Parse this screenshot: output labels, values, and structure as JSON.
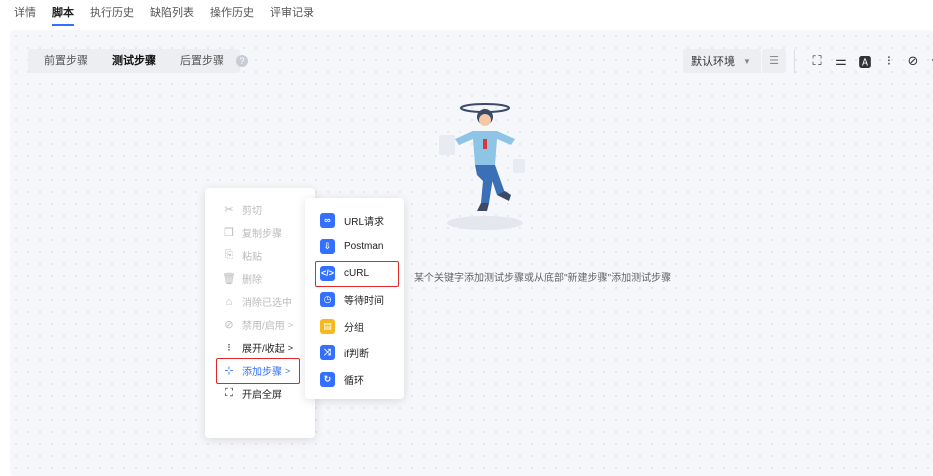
{
  "top_tabs": [
    "详情",
    "脚本",
    "执行历史",
    "缺陷列表",
    "操作历史",
    "评审记录"
  ],
  "active_tab": "脚本",
  "steps_tabs": {
    "pre": "前置步骤",
    "test": "测试步骤",
    "post": "后置步骤"
  },
  "environment": {
    "selected": "默认环境"
  },
  "empty_hint": "某个关键字添加测试步骤或从底部\"新建步骤\"添加测试步骤",
  "context_menu": [
    {
      "label": "剪切",
      "icon": "scissors-icon",
      "enabled": false
    },
    {
      "label": "复制步骤",
      "icon": "copy-icon",
      "enabled": false
    },
    {
      "label": "粘贴",
      "icon": "paste-icon",
      "enabled": false
    },
    {
      "label": "删除",
      "icon": "trash-icon",
      "enabled": false
    },
    {
      "label": "消除已选中",
      "icon": "basket-icon",
      "enabled": false
    },
    {
      "label": "禁用/启用",
      "icon": "disable-icon",
      "enabled": false,
      "arrow": ">"
    },
    {
      "label": "展开/收起",
      "icon": "expand-icon",
      "enabled": true,
      "arrow": ">"
    },
    {
      "label": "添加步骤",
      "icon": "add-step-icon",
      "enabled": true,
      "active": true,
      "arrow": ">"
    },
    {
      "label": "开启全屏",
      "icon": "fullscreen-icon",
      "enabled": true
    }
  ],
  "submenu": [
    {
      "label": "URL请求",
      "icon": "link-icon",
      "color": "#3370ff"
    },
    {
      "label": "Postman",
      "icon": "postman-icon",
      "color": "#3370ff"
    },
    {
      "label": "cURL",
      "icon": "code-icon",
      "color": "#3370ff"
    },
    {
      "label": "等待时间",
      "icon": "clock-icon",
      "color": "#3370ff"
    },
    {
      "label": "分组",
      "icon": "folder-icon",
      "color": "#f5b81d"
    },
    {
      "label": "if判断",
      "icon": "branch-icon",
      "color": "#3370ff"
    },
    {
      "label": "循环",
      "icon": "loop-icon",
      "color": "#3370ff"
    }
  ],
  "colors": {
    "accent": "#3370ff",
    "highlight_border": "#e02828"
  }
}
